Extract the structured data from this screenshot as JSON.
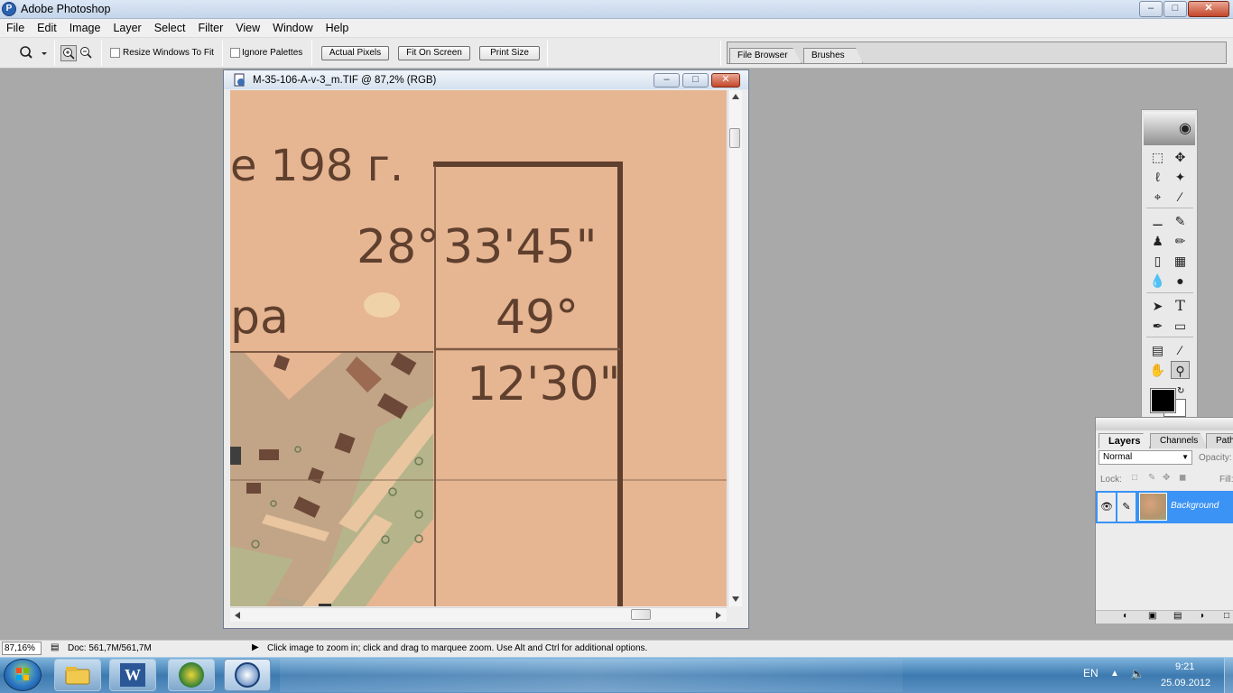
{
  "app": {
    "title": "Adobe Photoshop",
    "icon": "photoshop-icon"
  },
  "window_controls": {
    "minimize": "–",
    "maximize": "□",
    "close": "✕"
  },
  "menu": [
    "File",
    "Edit",
    "Image",
    "Layer",
    "Select",
    "Filter",
    "View",
    "Window",
    "Help"
  ],
  "options_bar": {
    "zoom_tool_icon": "magnifier-icon",
    "resize_windows_to_fit": "Resize Windows To Fit",
    "ignore_palettes": "Ignore Palettes",
    "actual_pixels": "Actual Pixels",
    "fit_on_screen": "Fit On Screen",
    "print_size": "Print Size"
  },
  "palette_well": {
    "tabs": [
      "File Browser",
      "Brushes"
    ]
  },
  "document": {
    "title": "M-35-106-A-v-3_m.TIF @ 87,2% (RGB)",
    "map_text": {
      "year": "е 198 г.",
      "lon_deg": "28°",
      "lon_min": "33'45\"",
      "lat_deg": "49°",
      "lat_min": "12'30\"",
      "fragment": "ра"
    }
  },
  "tools": {
    "header_icon": "eye-feather-icon"
  },
  "layers_panel": {
    "tabs": [
      "Layers",
      "Channels",
      "Paths"
    ],
    "blend_mode": "Normal",
    "opacity_label": "Opacity:",
    "lock_label": "Lock:",
    "fill_label": "Fill:",
    "layer_name": "Background"
  },
  "status_bar": {
    "zoom": "87,16%",
    "doc": "Doc: 561,7M/561,7M",
    "hint": "Click image to zoom in; click and drag to marquee zoom.  Use Alt and Ctrl for additional options."
  },
  "taskbar": {
    "apps": [
      "explorer-icon",
      "word-icon",
      "app-icon",
      "photoshop-icon"
    ],
    "word_glyph": "W",
    "lang": "EN",
    "time": "9:21",
    "date": "25.09.2012"
  },
  "colors": {
    "canvas": "#e6b592",
    "map_ink": "#5f3f2d",
    "layer_selected": "#3a93f5"
  }
}
